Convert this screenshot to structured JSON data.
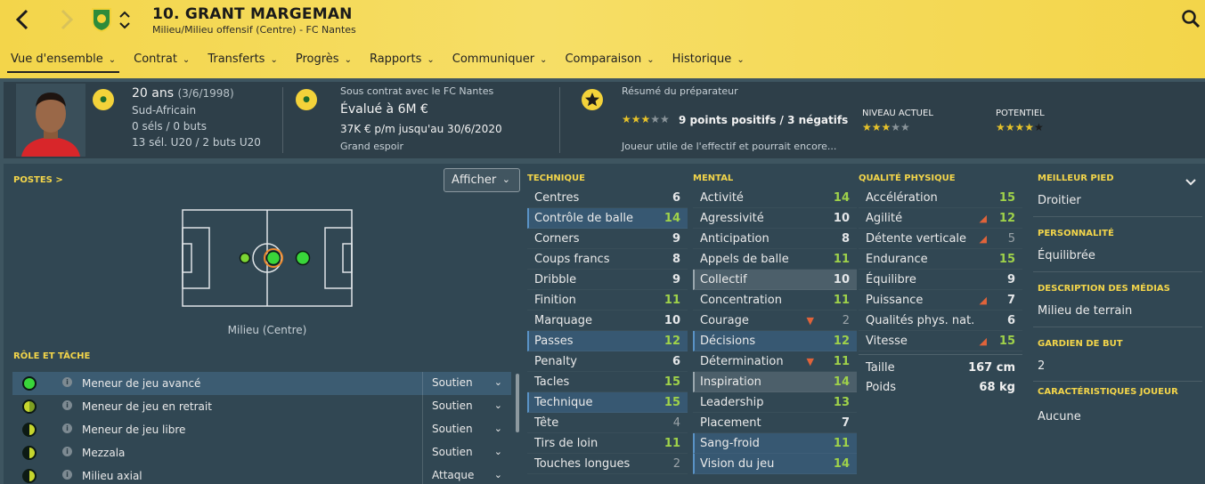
{
  "header": {
    "title": "10. GRANT MARGEMAN",
    "subtitle": "Milieu/Milieu offensif (Centre) - FC Nantes"
  },
  "nav": {
    "items": [
      {
        "label": "Vue d'ensemble"
      },
      {
        "label": "Contrat"
      },
      {
        "label": "Transferts"
      },
      {
        "label": "Progrès"
      },
      {
        "label": "Rapports"
      },
      {
        "label": "Communiquer"
      },
      {
        "label": "Comparaison"
      },
      {
        "label": "Historique"
      }
    ]
  },
  "info": {
    "age": "20 ans",
    "dob": "(3/6/1998)",
    "nationality": "Sud-Africain",
    "caps": "0 séls / 0 buts",
    "youth_caps": "13 sél. U20 / 2 buts U20",
    "contract_with": "Sous contrat avec le FC Nantes",
    "value": "Évalué à 6M €",
    "wage": "37K € p/m jusqu'au 30/6/2020",
    "status": "Grand espoir",
    "coach_title": "Résumé du préparateur",
    "coach_points": "9 points positifs / 3 négatifs",
    "coach_summary": "Joueur utile de l'effectif et pourrait encore...",
    "current_label": "NIVEAU ACTUEL",
    "potential_label": "POTENTIEL",
    "summary_stars": 3,
    "current_stars": 3,
    "potential_stars": 4.5
  },
  "positions": {
    "label": "POSTES >",
    "show_button": "Afficher",
    "pitch_label": "Milieu (Centre)"
  },
  "roles": {
    "label": "RÔLE ET TÂCHE",
    "items": [
      {
        "name": "Meneur de jeu avancé",
        "duty": "Soutien"
      },
      {
        "name": "Meneur de jeu en retrait",
        "duty": "Soutien"
      },
      {
        "name": "Meneur de jeu libre",
        "duty": "Soutien"
      },
      {
        "name": "Mezzala",
        "duty": "Soutien"
      },
      {
        "name": "Milieu axial",
        "duty": "Attaque"
      }
    ]
  },
  "technique": {
    "label": "TECHNIQUE",
    "rows": [
      {
        "name": "Centres",
        "value": "6"
      },
      {
        "name": "Contrôle de balle",
        "value": "14"
      },
      {
        "name": "Corners",
        "value": "9"
      },
      {
        "name": "Coups francs",
        "value": "8"
      },
      {
        "name": "Dribble",
        "value": "9"
      },
      {
        "name": "Finition",
        "value": "11"
      },
      {
        "name": "Marquage",
        "value": "10"
      },
      {
        "name": "Passes",
        "value": "12"
      },
      {
        "name": "Penalty",
        "value": "6"
      },
      {
        "name": "Tacles",
        "value": "15"
      },
      {
        "name": "Technique",
        "value": "15"
      },
      {
        "name": "Tête",
        "value": "4"
      },
      {
        "name": "Tirs de loin",
        "value": "11"
      },
      {
        "name": "Touches longues",
        "value": "2"
      }
    ]
  },
  "mental": {
    "label": "MENTAL",
    "rows": [
      {
        "name": "Activité",
        "value": "14"
      },
      {
        "name": "Agressivité",
        "value": "10"
      },
      {
        "name": "Anticipation",
        "value": "8"
      },
      {
        "name": "Appels de balle",
        "value": "11"
      },
      {
        "name": "Collectif",
        "value": "10"
      },
      {
        "name": "Concentration",
        "value": "11"
      },
      {
        "name": "Courage",
        "value": "2"
      },
      {
        "name": "Décisions",
        "value": "12"
      },
      {
        "name": "Détermination",
        "value": "11"
      },
      {
        "name": "Inspiration",
        "value": "14"
      },
      {
        "name": "Leadership",
        "value": "13"
      },
      {
        "name": "Placement",
        "value": "7"
      },
      {
        "name": "Sang-froid",
        "value": "11"
      },
      {
        "name": "Vision du jeu",
        "value": "14"
      }
    ]
  },
  "physical": {
    "label": "QUALITÉ PHYSIQUE",
    "rows": [
      {
        "name": "Accélération",
        "value": "15"
      },
      {
        "name": "Agilité",
        "value": "12"
      },
      {
        "name": "Détente verticale",
        "value": "5"
      },
      {
        "name": "Endurance",
        "value": "15"
      },
      {
        "name": "Équilibre",
        "value": "9"
      },
      {
        "name": "Puissance",
        "value": "7"
      },
      {
        "name": "Qualités phys. nat.",
        "value": "6"
      },
      {
        "name": "Vitesse",
        "value": "15"
      }
    ],
    "height_label": "Taille",
    "height_value": "167 cm",
    "weight_label": "Poids",
    "weight_value": "68 kg"
  },
  "side": {
    "foot_label": "MEILLEUR PIED",
    "foot_value": "Droitier",
    "personality_label": "PERSONNALITÉ",
    "personality_value": "Équilibrée",
    "media_label": "DESCRIPTION DES MÉDIAS",
    "media_value": "Milieu de terrain",
    "gk_label": "GARDIEN DE BUT",
    "gk_value": "2",
    "traits_label": "CARACTÉRISTIQUES JOUEUR",
    "traits_value": "Aucune"
  },
  "colors": {
    "accent_yellow": "#f3d54a",
    "high_green": "#9fd24a",
    "selected_blue": "#466e8c"
  }
}
